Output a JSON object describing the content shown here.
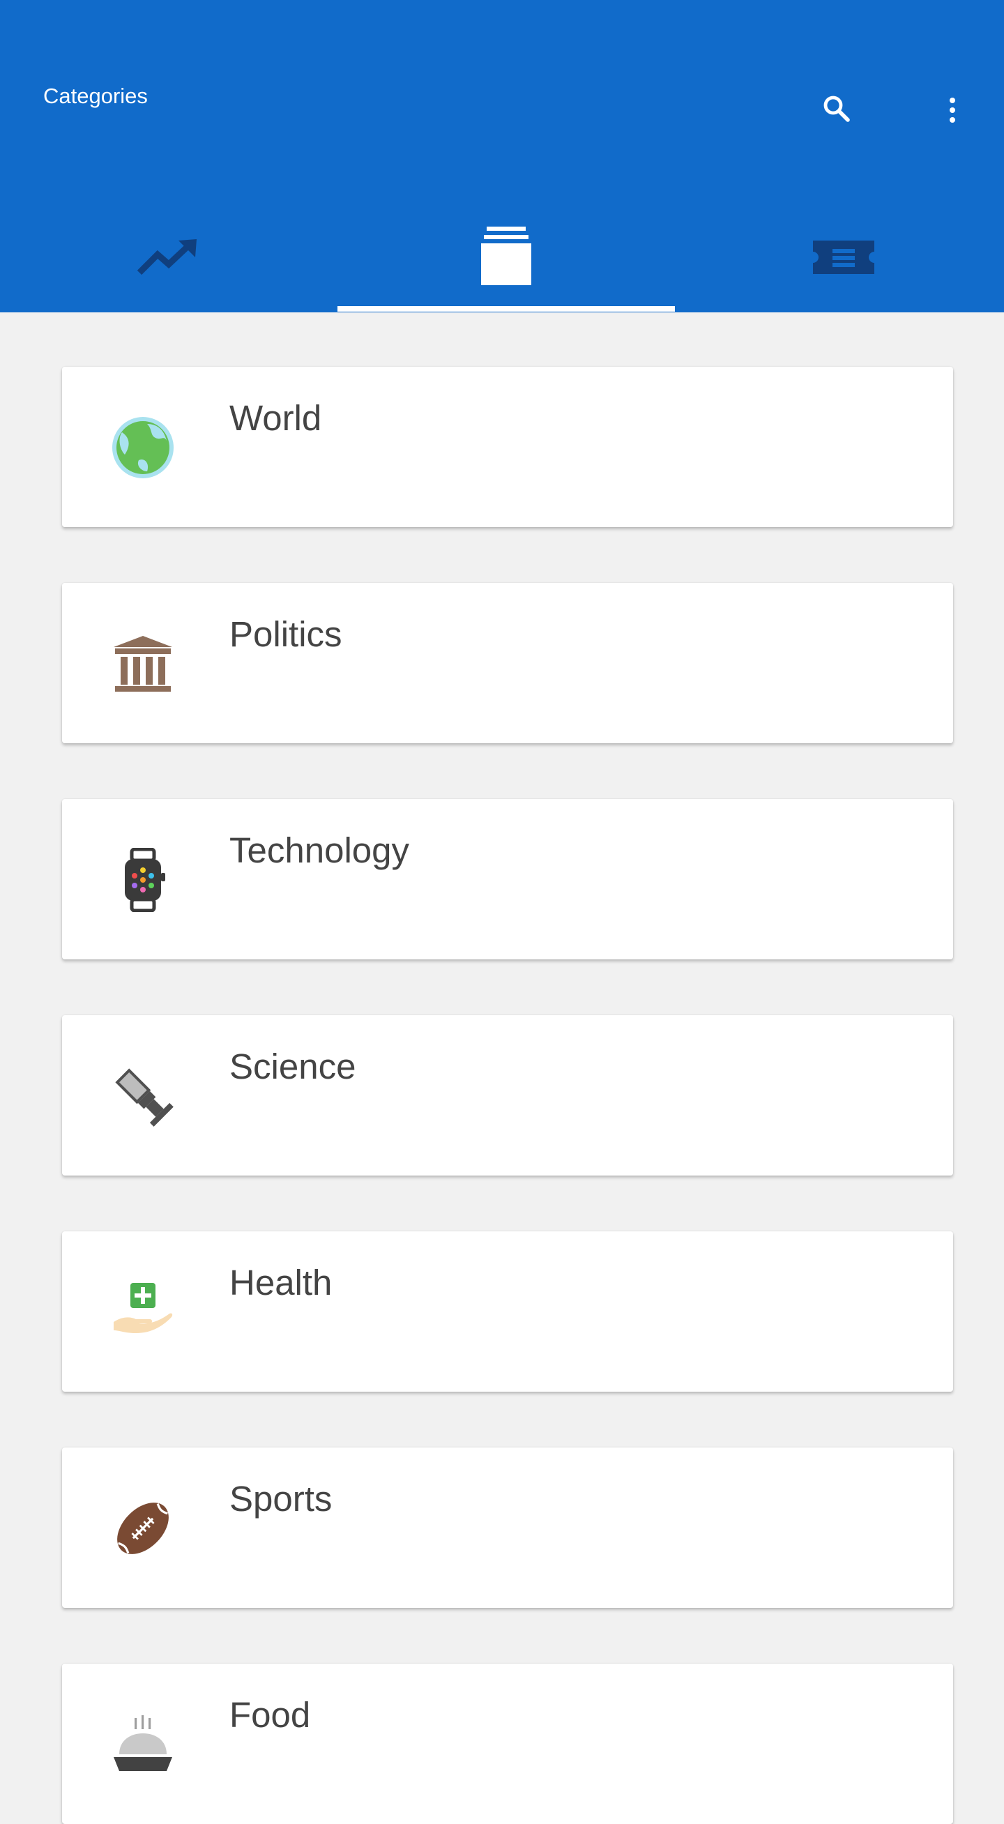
{
  "header": {
    "title": "Categories",
    "search_icon": "search-icon",
    "more_icon": "more-vert-icon"
  },
  "tabs": [
    {
      "icon": "trending-up-icon",
      "selected": false
    },
    {
      "icon": "layers-stack-icon",
      "selected": true
    },
    {
      "icon": "ticket-icon",
      "selected": false
    }
  ],
  "categories": [
    {
      "label": "World",
      "icon": "globe-icon"
    },
    {
      "label": "Politics",
      "icon": "government-building-icon"
    },
    {
      "label": "Technology",
      "icon": "smartwatch-icon"
    },
    {
      "label": "Science",
      "icon": "telescope-icon"
    },
    {
      "label": "Health",
      "icon": "health-hand-icon"
    },
    {
      "label": "Sports",
      "icon": "football-icon"
    },
    {
      "label": "Food",
      "icon": "food-cloche-icon"
    }
  ],
  "colors": {
    "primary": "#116bca",
    "background": "#f1f1f1",
    "card": "#ffffff",
    "text": "#444444"
  }
}
